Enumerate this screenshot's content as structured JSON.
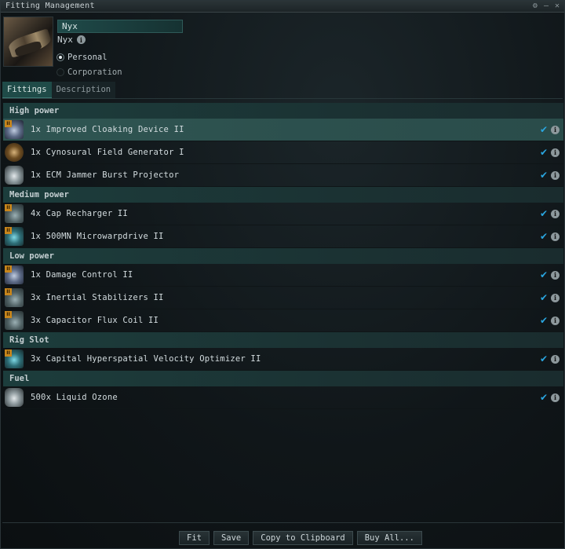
{
  "window": {
    "title": "Fitting Management",
    "icons": [
      "gear-icon",
      "minimize-icon",
      "close-icon"
    ]
  },
  "fitting": {
    "name": "Nyx",
    "ship_type": "Nyx"
  },
  "ownership": {
    "options": [
      "Personal",
      "Corporation"
    ],
    "selected": "Personal"
  },
  "tabs": [
    {
      "label": "Fittings",
      "active": true
    },
    {
      "label": "Description",
      "active": false
    }
  ],
  "sections": [
    {
      "title": "High power",
      "modules": [
        {
          "label": "1x Improved Cloaking Device II",
          "icon": "cloak-icon",
          "selected": true
        },
        {
          "label": "1x Cynosural Field Generator I",
          "icon": "cyno-icon",
          "selected": false
        },
        {
          "label": "1x ECM Jammer Burst Projector",
          "icon": "ecm-burst-icon",
          "selected": false
        }
      ]
    },
    {
      "title": "Medium power",
      "modules": [
        {
          "label": "4x Cap Recharger II",
          "icon": "cap-recharger-icon",
          "selected": false
        },
        {
          "label": "1x 500MN Microwarpdrive II",
          "icon": "microwarpdrive-icon",
          "selected": false
        }
      ]
    },
    {
      "title": "Low power",
      "modules": [
        {
          "label": "1x Damage Control II",
          "icon": "damage-control-icon",
          "selected": false
        },
        {
          "label": "3x Inertial Stabilizers II",
          "icon": "inertial-stabilizer-icon",
          "selected": false
        },
        {
          "label": "3x Capacitor Flux Coil II",
          "icon": "flux-coil-icon",
          "selected": false
        }
      ]
    },
    {
      "title": "Rig Slot",
      "modules": [
        {
          "label": "3x Capital Hyperspatial Velocity Optimizer II",
          "icon": "rig-icon",
          "selected": false
        }
      ]
    },
    {
      "title": "Fuel",
      "modules": [
        {
          "label": "500x Liquid Ozone",
          "icon": "liquid-ozone-icon",
          "selected": false
        }
      ]
    }
  ],
  "buttons": {
    "fit": "Fit",
    "save": "Save",
    "copy": "Copy to Clipboard",
    "buy": "Buy All..."
  },
  "colors": {
    "accent": "#2aa6e0",
    "selected_row": "#2f5552",
    "section_bg": "#1c3d3c",
    "t2_badge": "#c8861c"
  }
}
